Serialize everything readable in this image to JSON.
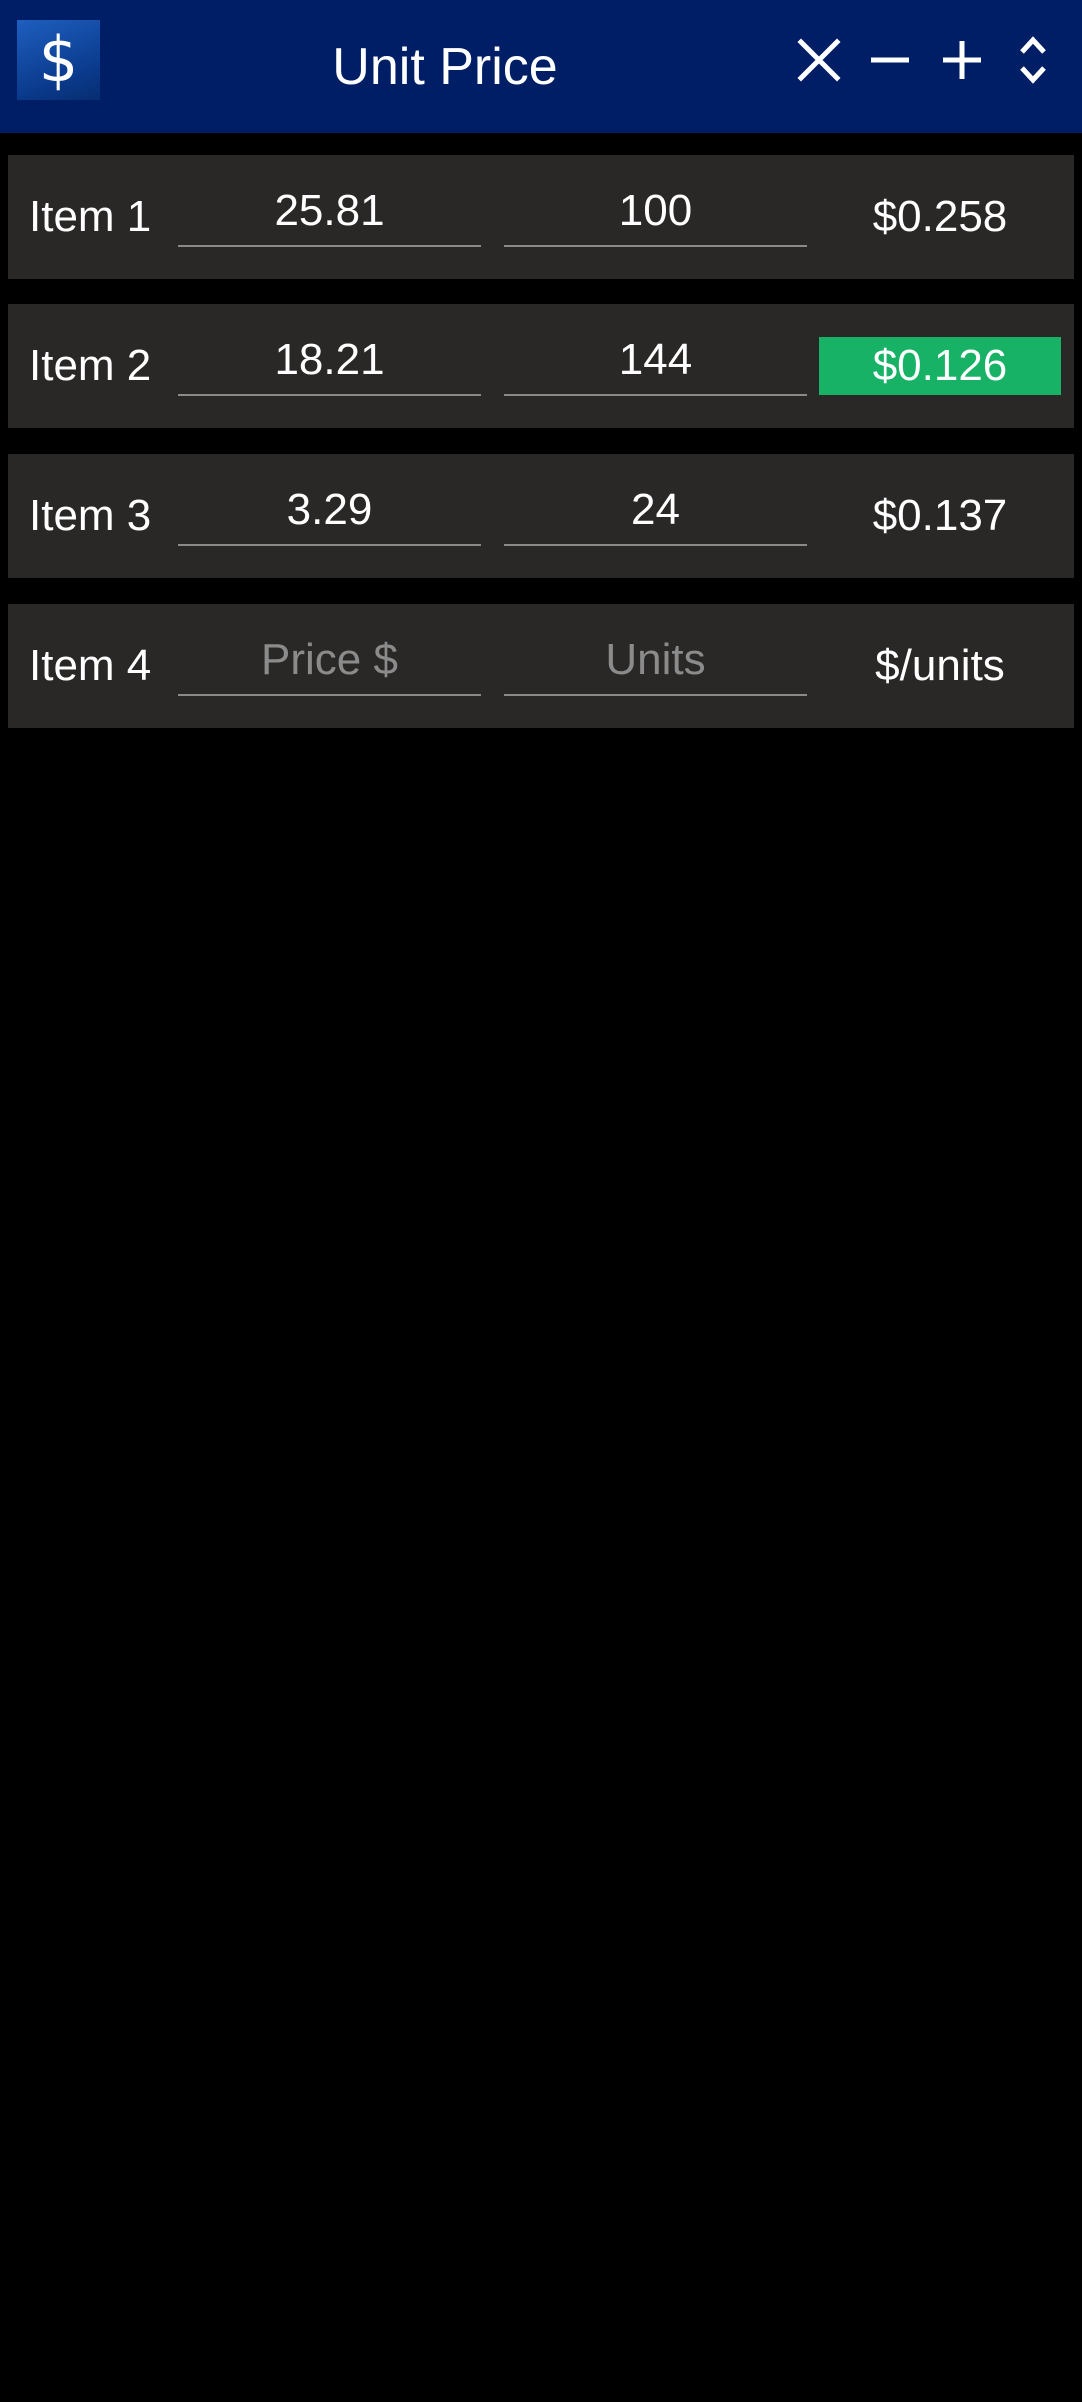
{
  "app": {
    "logo_symbol": "$",
    "title": "Unit Price",
    "accent_color": "#001e66",
    "best_color": "#17b266"
  },
  "toolbar": {
    "actions": [
      {
        "name": "clear",
        "icon": "close-icon"
      },
      {
        "name": "remove-item",
        "icon": "minus-icon"
      },
      {
        "name": "add-item",
        "icon": "plus-icon"
      },
      {
        "name": "sort",
        "icon": "sort-icon"
      }
    ]
  },
  "items": [
    {
      "label": "Item 1",
      "price": "25.81",
      "units": "100",
      "unit_price": "$0.258",
      "best": false,
      "price_placeholder": "Price $",
      "units_placeholder": "Units"
    },
    {
      "label": "Item 2",
      "price": "18.21",
      "units": "144",
      "unit_price": "$0.126",
      "best": true,
      "price_placeholder": "Price $",
      "units_placeholder": "Units"
    },
    {
      "label": "Item 3",
      "price": "3.29",
      "units": "24",
      "unit_price": "$0.137",
      "best": false,
      "price_placeholder": "Price $",
      "units_placeholder": "Units"
    },
    {
      "label": "Item 4",
      "price": "",
      "units": "",
      "unit_price": "$/units",
      "best": false,
      "price_placeholder": "Price $",
      "units_placeholder": "Units"
    }
  ]
}
